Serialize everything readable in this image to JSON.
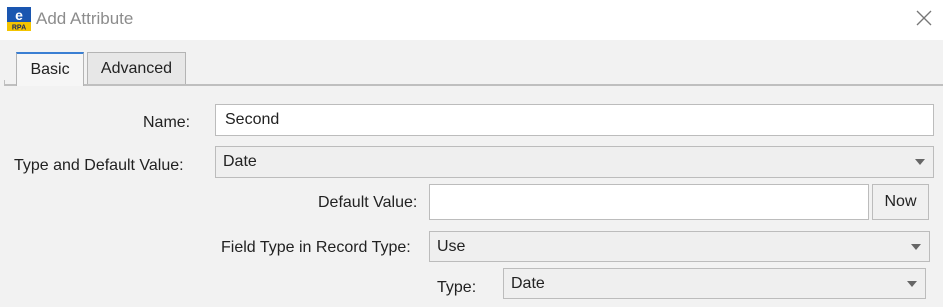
{
  "window": {
    "title": "Add Attribute",
    "icon": "erpa-app-icon",
    "close_icon": "close-icon"
  },
  "tabs": [
    {
      "label": "Basic",
      "active": true
    },
    {
      "label": "Advanced",
      "active": false
    }
  ],
  "form": {
    "name_label": "Name:",
    "name_value": "Second",
    "type_default_label": "Type and Default Value:",
    "type_default_value": "Date",
    "default_value_label": "Default Value:",
    "default_value": "",
    "now_button": "Now",
    "field_type_label": "Field Type in Record Type:",
    "field_type_value": "Use",
    "type_label": "Type:",
    "type_value": "Date"
  },
  "colors": {
    "active_tab_accent": "#3a7fd3",
    "logo_blue": "#1a56b0",
    "logo_yellow": "#f3c400"
  }
}
